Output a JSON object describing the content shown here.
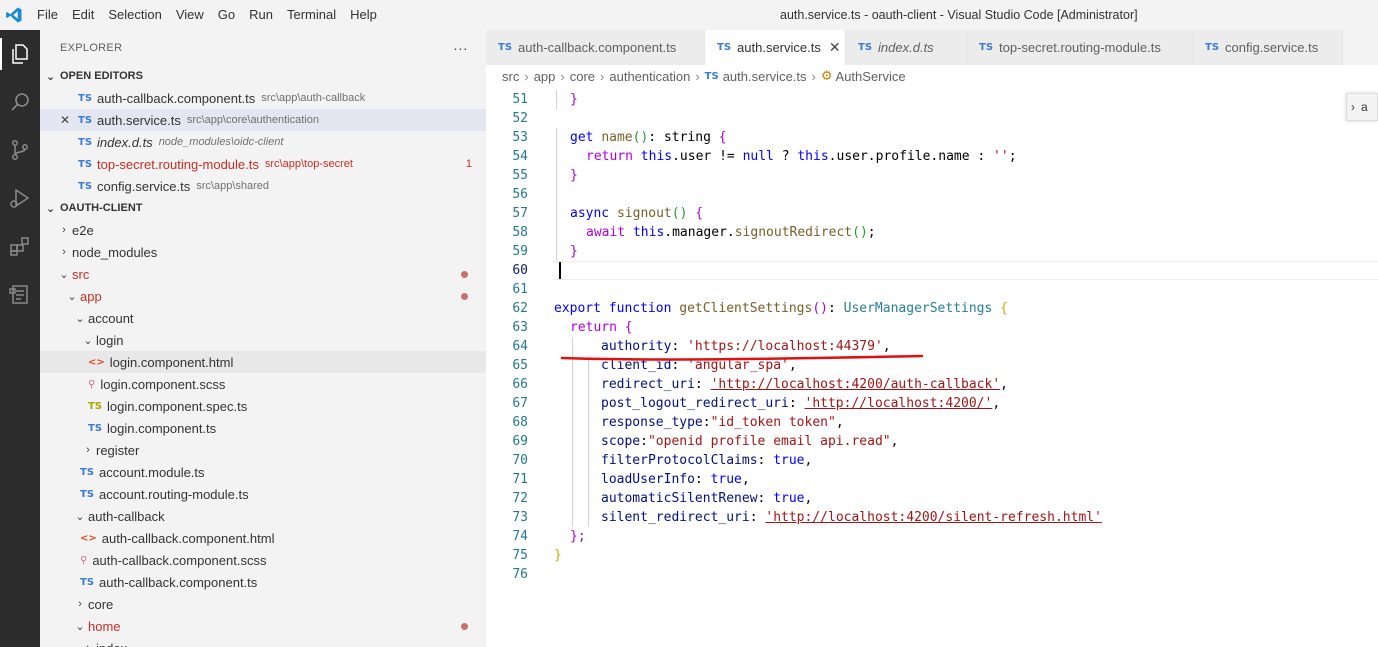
{
  "window": {
    "title": "auth.service.ts - oauth-client - Visual Studio Code [Administrator]",
    "menu": [
      "File",
      "Edit",
      "Selection",
      "View",
      "Go",
      "Run",
      "Terminal",
      "Help"
    ]
  },
  "activity_bar": {
    "icons": [
      "files-icon",
      "search-icon",
      "source-control-icon",
      "run-debug-icon",
      "extensions-icon",
      "remote-explorer-icon"
    ]
  },
  "sidebar": {
    "header": "EXPLORER",
    "more_label": "···",
    "open_editors": {
      "title": "OPEN EDITORS",
      "items": [
        {
          "icon": "TS",
          "name": "auth-callback.component.ts",
          "path": "src\\app\\auth-callback"
        },
        {
          "icon": "TS",
          "name": "auth.service.ts",
          "path": "src\\app\\core\\authentication",
          "close": "✕"
        },
        {
          "icon": "TS",
          "name": "index.d.ts",
          "path": "node_modules\\oidc-client"
        },
        {
          "icon": "TS",
          "name": "top-secret.routing-module.ts",
          "path": "src\\app\\top-secret",
          "badge": "1"
        },
        {
          "icon": "TS",
          "name": "config.service.ts",
          "path": "src\\app\\shared"
        }
      ]
    },
    "project": {
      "title": "OAUTH-CLIENT",
      "tree": [
        {
          "label": "e2e"
        },
        {
          "label": "node_modules"
        },
        {
          "label": "src"
        },
        {
          "label": "app"
        },
        {
          "label": "account"
        },
        {
          "label": "login"
        },
        {
          "label": "login.component.html",
          "icon": "<>"
        },
        {
          "label": "login.component.scss",
          "icon": "⚲"
        },
        {
          "label": "login.component.spec.ts",
          "icon": "TS"
        },
        {
          "label": "login.component.ts",
          "icon": "TS"
        },
        {
          "label": "register"
        },
        {
          "label": "account.module.ts",
          "icon": "TS"
        },
        {
          "label": "account.routing-module.ts",
          "icon": "TS"
        },
        {
          "label": "auth-callback"
        },
        {
          "label": "auth-callback.component.html",
          "icon": "<>"
        },
        {
          "label": "auth-callback.component.scss",
          "icon": "⚲"
        },
        {
          "label": "auth-callback.component.ts",
          "icon": "TS"
        },
        {
          "label": "core"
        },
        {
          "label": "home"
        },
        {
          "label": "index"
        }
      ]
    }
  },
  "tabs": [
    {
      "icon": "TS",
      "label": "auth-callback.component.ts"
    },
    {
      "icon": "TS",
      "label": "auth.service.ts",
      "close": "✕"
    },
    {
      "icon": "TS",
      "label": "index.d.ts"
    },
    {
      "icon": "TS",
      "label": "top-secret.routing-module.ts"
    },
    {
      "icon": "TS",
      "label": "config.service.ts"
    }
  ],
  "breadcrumb": {
    "items": [
      "src",
      "app",
      "core",
      "authentication"
    ],
    "file_icon": "TS",
    "file": "auth.service.ts",
    "class_icon": "⚙",
    "symbol": "AuthService"
  },
  "editor": {
    "line_numbers": [
      "51",
      "52",
      "53",
      "54",
      "55",
      "56",
      "57",
      "58",
      "59",
      "60",
      "61",
      "62",
      "63",
      "64",
      "65",
      "66",
      "67",
      "68",
      "69",
      "70",
      "71",
      "72",
      "73",
      "74",
      "75",
      "76"
    ],
    "code": {
      "l53_kw": "get",
      "l53_fn": "name",
      "l53_p": "()",
      "l53_type": ": string ",
      "l53_b": "{",
      "l54_kw": "return",
      "l54_this": "this",
      "l54_a": ".user != ",
      "l54_null": "null",
      "l54_b": " ? ",
      "l54_this2": "this",
      "l54_c": ".user.profile.name : ",
      "l54_str": "''",
      "l54_d": ";",
      "l57_kw": "async",
      "l57_fn": "signout",
      "l57_p": "()",
      "l57_b": "{",
      "l58_kw": "await",
      "l58_this": "this",
      "l58_a": ".manager.",
      "l58_fn": "signoutRedirect",
      "l58_p": "()",
      "l58_d": ";",
      "l62_kw1": "export",
      "l62_kw2": "function",
      "l62_fn": "getClientSettings",
      "l62_p": "()",
      "l62_colon": ": ",
      "l62_type": "UserManagerSettings",
      "l62_b": "{",
      "l63_kw": "return",
      "l63_b": "{",
      "l64_k": "authority",
      "l64_v": "'https://localhost:44379'",
      "l65_k": "client_id",
      "l65_v": "'angular_spa'",
      "l66_k": "redirect_uri",
      "l66_v": "'http://localhost:4200/auth-callback'",
      "l67_k": "post_logout_redirect_uri",
      "l67_v": "'http://localhost:4200/'",
      "l68_k": "response_type",
      "l68_v": "\"id_token token\"",
      "l69_k": "scope",
      "l69_v": "\"openid profile email api.read\"",
      "l70_k": "filterProtocolClaims",
      "l70_v": "true",
      "l71_k": "loadUserInfo",
      "l71_v": "true",
      "l72_k": "automaticSilentRenew",
      "l72_v": "true",
      "l73_k": "silent_redirect_uri",
      "l73_v": "'http://localhost:4200/silent-refresh.html'",
      "l74": "};",
      "l75": "}"
    }
  },
  "peek_label": "a",
  "annotation_color": "#e01010"
}
